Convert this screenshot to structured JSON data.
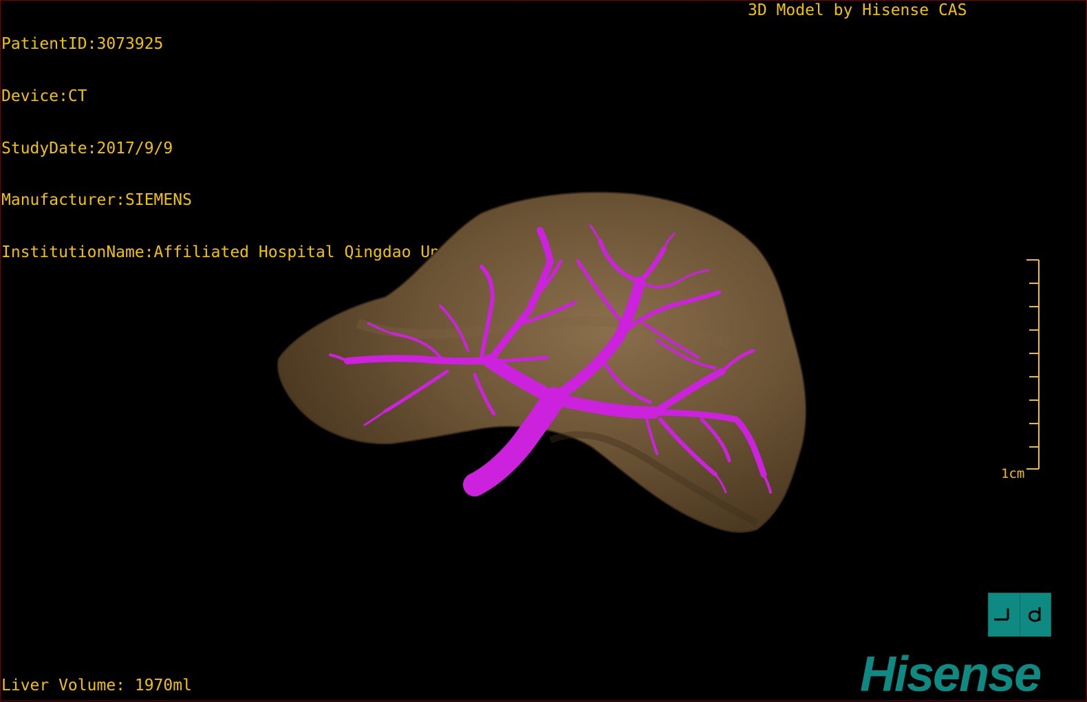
{
  "overlay": {
    "patient_id": "PatientID:3073925",
    "device": "Device:CT",
    "study_date": "StudyDate:2017/9/9",
    "manufacturer": "Manufacturer:SIEMENS",
    "institution": "InstitutionName:Affiliated Hospital Qingdao University-C",
    "model_credit": "3D Model by Hisense CAS",
    "liver_volume": "Liver Volume: 1970ml",
    "scale_label": "1cm"
  },
  "branding": {
    "logo_text": "Hisense"
  },
  "view": {
    "orientation_icon": "orientation-cube-icon",
    "orientation_left_glyph": "┴",
    "orientation_right_glyph": "d",
    "liver_color": "#6b5335",
    "vessel_color": "#cc22dd",
    "text_color": "#f2c200",
    "brand_color": "#0f8a82"
  }
}
